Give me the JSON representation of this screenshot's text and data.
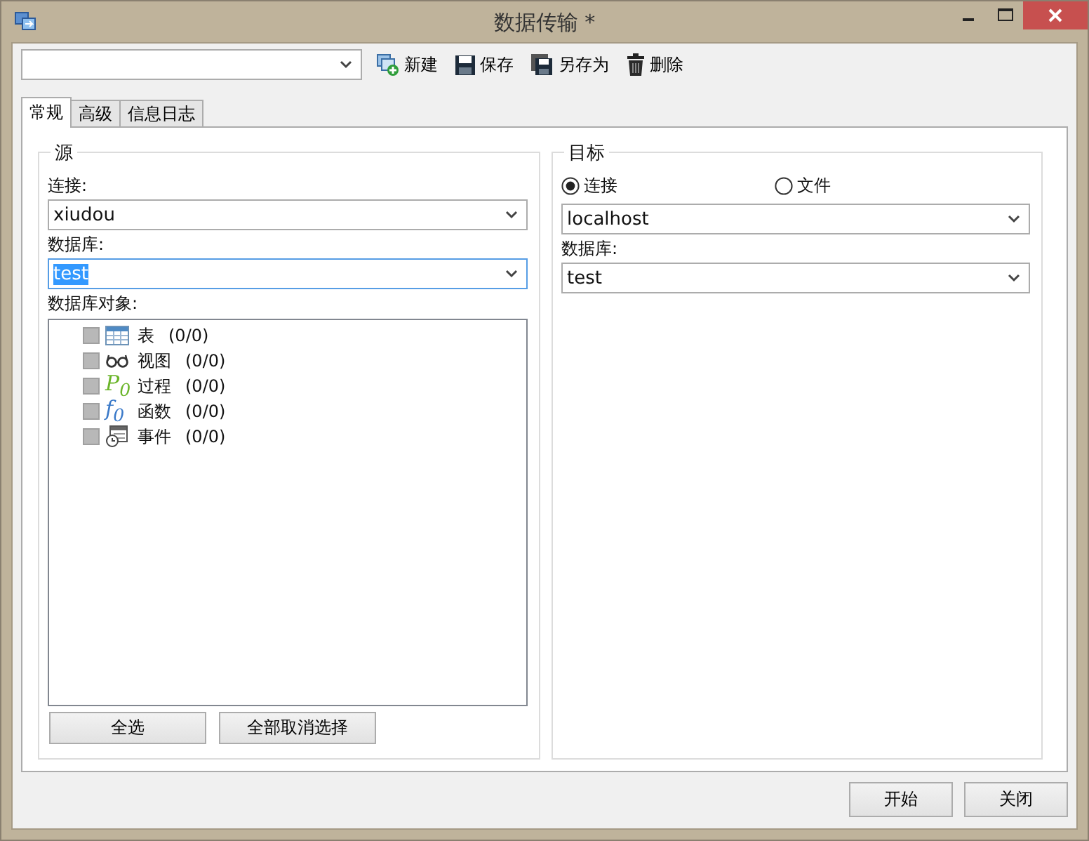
{
  "window": {
    "title": "数据传输 *"
  },
  "toolbar": {
    "buttons": [
      {
        "label": "新建",
        "kind": "new"
      },
      {
        "label": "保存",
        "kind": "save"
      },
      {
        "label": "另存为",
        "kind": "saveas"
      },
      {
        "label": "删除",
        "kind": "delete"
      }
    ]
  },
  "tabs": [
    {
      "label": "常规",
      "selected": true
    },
    {
      "label": "高级",
      "selected": false
    },
    {
      "label": "信息日志",
      "selected": false
    }
  ],
  "source": {
    "title": "源",
    "connection_label": "连接:",
    "connection": "xiudou",
    "database_label": "数据库:",
    "database": "test",
    "database_focused": true,
    "objects_label": "数据库对象:",
    "objects": [
      {
        "kind": "table",
        "label": "表",
        "count": "(0/0)",
        "checked": false
      },
      {
        "kind": "view",
        "label": "视图",
        "count": "(0/0)",
        "checked": false
      },
      {
        "kind": "procedure",
        "glyph": "P$_{0}$",
        "label": "过程",
        "count": "(0/0)",
        "checked": false
      },
      {
        "kind": "function",
        "glyph": "f$_{0}$",
        "label": "函数",
        "count": "(0/0)",
        "checked": false
      },
      {
        "kind": "event",
        "label": "事件",
        "count": "(0/0)",
        "checked": false
      }
    ],
    "buttons": [
      "全选",
      "全部取消选择"
    ]
  },
  "target": {
    "title": "目标",
    "modes": [
      {
        "label": "连接",
        "selected": true
      },
      {
        "label": "文件",
        "selected": false
      }
    ],
    "connection": "localhost",
    "database_label": "数据库:",
    "database": "test"
  },
  "footer_buttons": [
    "开始",
    "关闭"
  ]
}
